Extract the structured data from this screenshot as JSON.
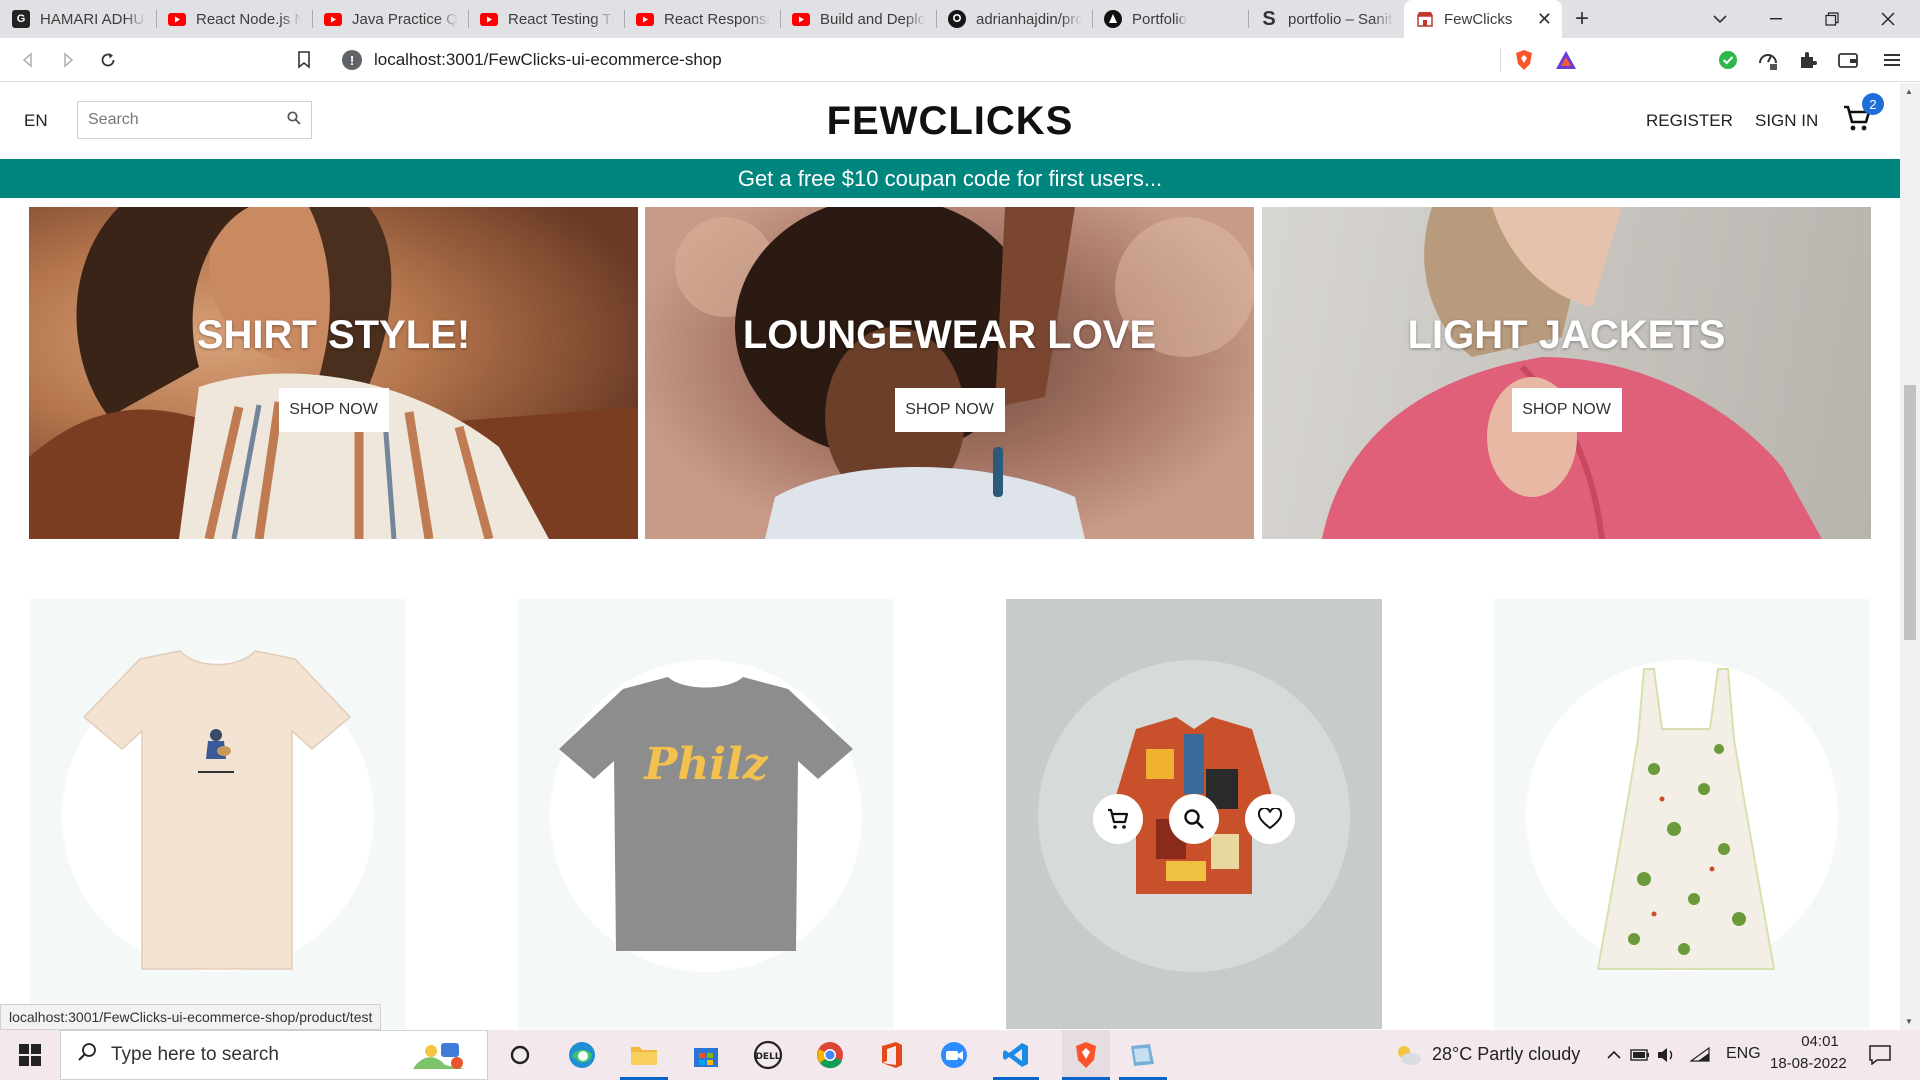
{
  "browser": {
    "tabs": [
      {
        "title": "HAMARI ADHURI",
        "icon": "grammarly-icon",
        "color": "#222222"
      },
      {
        "title": "React Node.js Ne",
        "icon": "youtube-icon",
        "color": "#ff0000"
      },
      {
        "title": "Java Practice Que",
        "icon": "youtube-icon",
        "color": "#ff0000"
      },
      {
        "title": "React Testing Tut",
        "icon": "youtube-icon",
        "color": "#ff0000"
      },
      {
        "title": "React Responsive",
        "icon": "youtube-icon",
        "color": "#ff0000"
      },
      {
        "title": "Build and Deploy",
        "icon": "youtube-icon",
        "color": "#ff0000"
      },
      {
        "title": "adrianhajdin/pro",
        "icon": "github-icon",
        "color": "#181717"
      },
      {
        "title": "Portfolio",
        "icon": "portfolio-icon",
        "color": "#111111"
      },
      {
        "title": "portfolio – Sanity",
        "icon": "sanity-icon",
        "color": "#333333"
      },
      {
        "title": "FewClicks",
        "icon": "shop-icon",
        "color": "#c0392b",
        "active": true
      }
    ],
    "url": "localhost:3001/FewClicks-ui-ecommerce-shop",
    "status_url": "localhost:3001/FewClicks-ui-ecommerce-shop/product/test"
  },
  "header": {
    "lang": "EN",
    "search_placeholder": "Search",
    "logo": "FEWCLICKS",
    "register": "REGISTER",
    "signin": "SIGN IN",
    "cart_count": "2"
  },
  "promo": "Get a free $10 coupan code for first users...",
  "categories": [
    {
      "title": "SHIRT STYLE!",
      "button": "SHOP NOW"
    },
    {
      "title": "LOUNGEWEAR LOVE",
      "button": "SHOP NOW"
    },
    {
      "title": "LIGHT JACKETS",
      "button": "SHOP NOW"
    }
  ],
  "products": [
    {
      "name": "cream-tshirt",
      "hover": false
    },
    {
      "name": "grey-philz-tshirt",
      "hover": false,
      "print": "Philz"
    },
    {
      "name": "patterned-shirt",
      "hover": true
    },
    {
      "name": "floral-dress",
      "hover": false
    }
  ],
  "taskbar": {
    "search_placeholder": "Type here to search",
    "weather": "28°C  Partly cloudy",
    "lang": "ENG",
    "time": "04:01",
    "date": "18-08-2022"
  },
  "colors": {
    "promo_bg": "#00857f",
    "cart_badge": "#1e6fd9"
  }
}
